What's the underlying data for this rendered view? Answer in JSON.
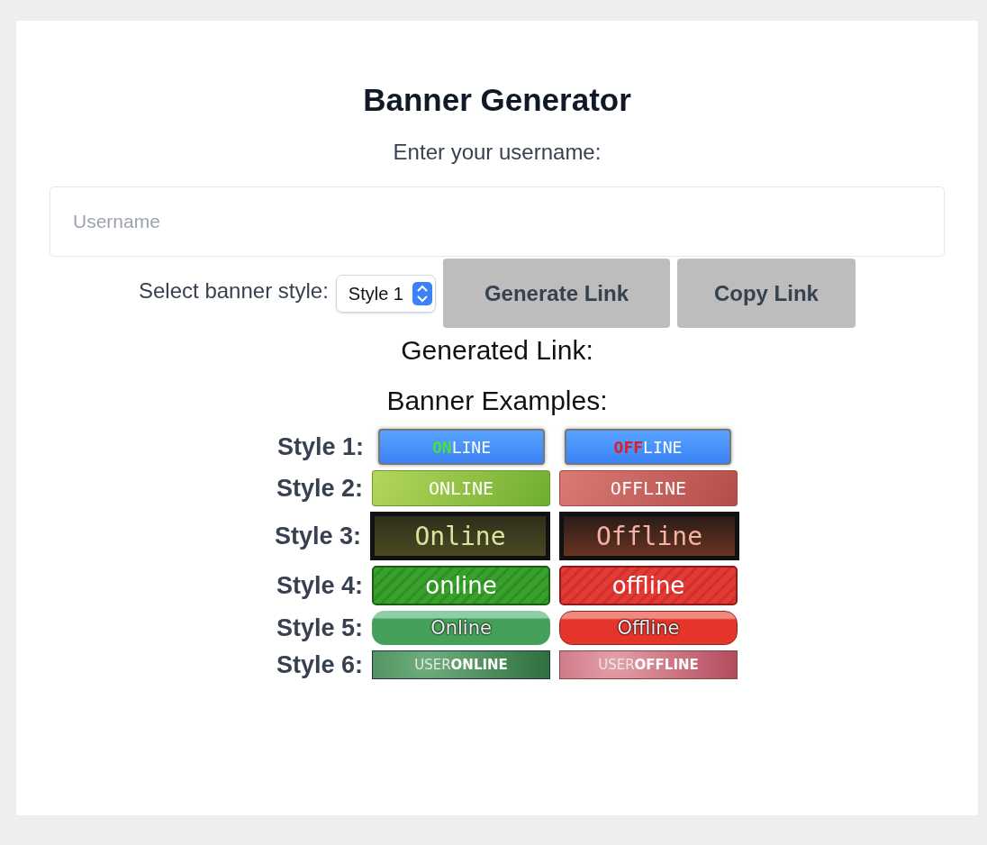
{
  "title": "Banner Generator",
  "username_label": "Enter your username:",
  "username_field": {
    "placeholder": "Username"
  },
  "style_label": "Select banner style:",
  "style_select": {
    "value": "Style 1"
  },
  "buttons": [
    "Generate Link",
    "Copy Link"
  ],
  "generated_link_label": "Generated Link:",
  "examples_heading": "Banner Examples:",
  "examples": [
    {
      "label": "Style 1:",
      "kind": "pixel-blue",
      "banners": [
        {
          "online": true,
          "parts": [
            {
              "text": "ON",
              "accent": true
            },
            {
              "text": "LINE",
              "accent": false
            }
          ]
        },
        {
          "online": false,
          "parts": [
            {
              "text": "OFF",
              "accent": true
            },
            {
              "text": "LINE",
              "accent": false
            }
          ]
        }
      ]
    },
    {
      "label": "Style 2:",
      "kind": "glossy",
      "banners": [
        {
          "online": true,
          "parts": [
            {
              "text": "ONLINE",
              "accent": false
            }
          ]
        },
        {
          "online": false,
          "parts": [
            {
              "text": "OFFLINE",
              "accent": false
            }
          ]
        }
      ]
    },
    {
      "label": "Style 3:",
      "kind": "dark",
      "banners": [
        {
          "online": true,
          "parts": [
            {
              "text": "Online",
              "accent": false
            }
          ]
        },
        {
          "online": false,
          "parts": [
            {
              "text": "Offline",
              "accent": false
            }
          ]
        }
      ]
    },
    {
      "label": "Style 4:",
      "kind": "striped",
      "banners": [
        {
          "online": true,
          "parts": [
            {
              "text": "online",
              "accent": false
            }
          ]
        },
        {
          "online": false,
          "parts": [
            {
              "text": "offline",
              "accent": false
            }
          ]
        }
      ]
    },
    {
      "label": "Style 5:",
      "kind": "pill",
      "banners": [
        {
          "online": true,
          "parts": [
            {
              "text": "Online",
              "accent": false
            }
          ]
        },
        {
          "online": false,
          "parts": [
            {
              "text": "Offline",
              "accent": false
            }
          ]
        }
      ]
    },
    {
      "label": "Style 6:",
      "kind": "sparkle",
      "banners": [
        {
          "online": true,
          "parts": [
            {
              "text": "USER",
              "accent": false
            },
            {
              "text": "ONLINE",
              "accent": true
            }
          ]
        },
        {
          "online": false,
          "parts": [
            {
              "text": "USER",
              "accent": false
            },
            {
              "text": "OFFLINE",
              "accent": true
            }
          ]
        }
      ]
    }
  ]
}
